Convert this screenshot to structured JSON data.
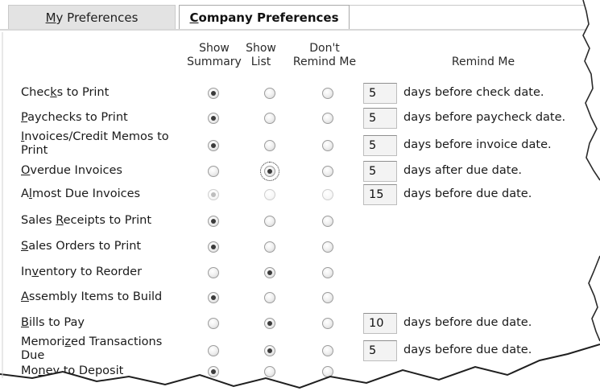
{
  "tabs": {
    "my_preferences": {
      "pre": "",
      "u": "M",
      "post": "y Preferences"
    },
    "company_preferences": {
      "pre": "",
      "u": "C",
      "post": "ompany Preferences"
    }
  },
  "headers": {
    "show_summary_1": "Show",
    "show_summary_2": "Summary",
    "show_list_1": "Show",
    "show_list_2": "List",
    "dont_remind_1": "Don't",
    "dont_remind_2": "Remind Me",
    "remind_me": "Remind Me"
  },
  "rows": [
    {
      "pre": "Chec",
      "u": "k",
      "post": "s to Print",
      "selected": "summary",
      "days": "5",
      "days_text": "days before check date."
    },
    {
      "pre": "",
      "u": "P",
      "post": "aychecks to Print",
      "selected": "summary",
      "days": "5",
      "days_text": "days before paycheck date."
    },
    {
      "pre": "",
      "u": "I",
      "post": "nvoices/Credit Memos to",
      "line2": "Print",
      "selected": "summary",
      "days": "5",
      "days_text": "days before invoice date."
    },
    {
      "pre": "",
      "u": "O",
      "post": "verdue Invoices",
      "selected": "list",
      "days": "5",
      "days_text": "days after due date."
    },
    {
      "pre": "A",
      "u": "l",
      "post": "most Due Invoices",
      "selected": "summary",
      "disabled": true,
      "days": "15",
      "days_text": "days before due date."
    },
    {
      "pre": "Sales ",
      "u": "R",
      "post": "eceipts to Print",
      "selected": "summary"
    },
    {
      "pre": "",
      "u": "S",
      "post": "ales Orders to Print",
      "selected": "summary"
    },
    {
      "pre": "In",
      "u": "v",
      "post": "entory to Reorder",
      "selected": "list"
    },
    {
      "pre": "",
      "u": "A",
      "post": "ssembly Items to Build",
      "selected": "summary"
    },
    {
      "pre": "",
      "u": "B",
      "post": "ills to Pay",
      "selected": "list",
      "days": "10",
      "days_text": "days before due date."
    },
    {
      "pre": "Memori",
      "u": "z",
      "post": "ed Transactions",
      "line2": "Due",
      "selected": "list",
      "days": "5",
      "days_text": "days before due date."
    },
    {
      "pre": "Mo",
      "u": "n",
      "post": "ey to Deposit",
      "selected": "summary"
    }
  ]
}
